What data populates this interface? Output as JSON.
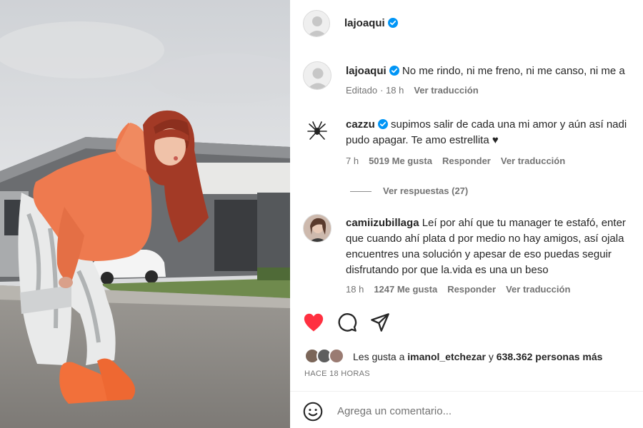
{
  "post": {
    "username": "lajoaqui",
    "verified_icon": "verified-badge-icon"
  },
  "comments": [
    {
      "username": "lajoaqui",
      "verified": true,
      "lines": [
        "No me rindo, ni me freno, ni me canso, ni me a"
      ],
      "meta": [
        "Editado",
        "· 18 h",
        "Ver traducción"
      ]
    },
    {
      "username": "cazzu",
      "verified": true,
      "lines": [
        "supimos salir de cada una mi amor y aún así nadi",
        "pudo apagar. Te amo estrellita ♥"
      ],
      "meta": [
        "7 h",
        "5019 Me gusta",
        "Responder",
        "Ver traducción"
      ],
      "replies_label": "Ver respuestas (27)"
    },
    {
      "username": "camiizubillaga",
      "verified": false,
      "lines": [
        "Leí por ahí que tu manager te estafó, enter",
        "que cuando ahí plata d por medio no hay amigos, así ojala",
        "encuentres una solución y apesar de eso puedas seguir",
        "disfrutando por que la.vida es una un beso"
      ],
      "meta": [
        "18 h",
        "1247 Me gusta",
        "Responder",
        "Ver traducción"
      ]
    }
  ],
  "actions": {
    "icons": [
      "heart-filled-icon",
      "comment-icon",
      "share-icon"
    ],
    "like_color": "#ff3040"
  },
  "likes": {
    "prefix": "Les gusta a ",
    "first_user": "imanol_etchezar",
    "middle": " y ",
    "count_text": "638.362 personas más"
  },
  "time_ago": "HACE 18 HORAS",
  "comment_box": {
    "placeholder": "Agrega un comentario...",
    "icon": "emoji-icon"
  },
  "colors": {
    "verified": "#0095f6",
    "muted": "#737373",
    "text": "#262626"
  }
}
